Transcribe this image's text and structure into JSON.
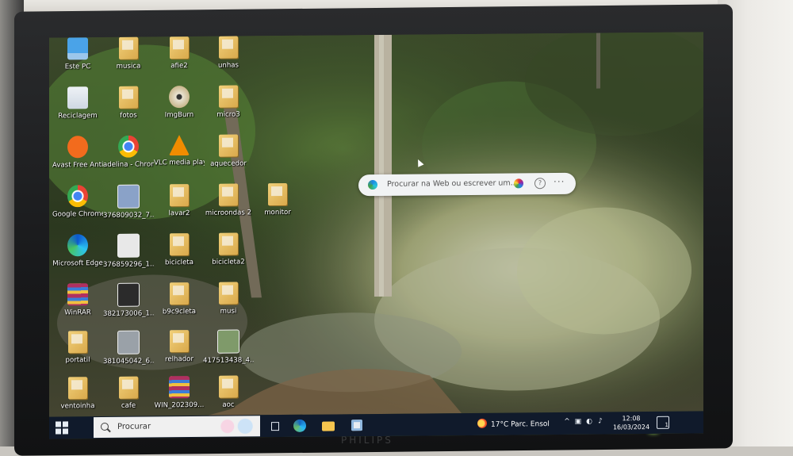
{
  "monitor": {
    "bottom_brand": "PHILIPS"
  },
  "desktop": {
    "icons": [
      {
        "label": "Este PC",
        "type": "pc",
        "color": "#4aa3e8"
      },
      {
        "label": "musica",
        "type": "folder"
      },
      {
        "label": "afie2",
        "type": "folder"
      },
      {
        "label": "unhas",
        "type": "folder"
      },
      {
        "label": "Reciclagem",
        "type": "recycle",
        "color": "#cfd8e3"
      },
      {
        "label": "fotos",
        "type": "folder"
      },
      {
        "label": "ImgBurn",
        "type": "disc",
        "color": "#c8b58a"
      },
      {
        "label": "micro3",
        "type": "folder"
      },
      {
        "label": "Avast Free Antivirus",
        "type": "avast",
        "color": "#f26b1d"
      },
      {
        "label": "adelina - Chrome",
        "type": "chrome"
      },
      {
        "label": "VLC media player",
        "type": "vlc",
        "color": "#f08c00"
      },
      {
        "label": "aquecedor",
        "type": "folder"
      },
      {
        "label": "Google Chrome",
        "type": "chrome"
      },
      {
        "label": "376809032_7...",
        "type": "photo",
        "color": "#8aa2c8"
      },
      {
        "label": "lavar2",
        "type": "folder"
      },
      {
        "label": "microondas 2",
        "type": "folder"
      },
      {
        "label": "monitor",
        "type": "folder"
      },
      {
        "label": "Microsoft Edge",
        "type": "edge"
      },
      {
        "label": "376859296_1...",
        "type": "file",
        "color": "#e8e8e8"
      },
      {
        "label": "bicicleta",
        "type": "folder"
      },
      {
        "label": "bicicleta2",
        "type": "folder"
      },
      {
        "label": "WinRAR",
        "type": "winrar",
        "color": "#b03060"
      },
      {
        "label": "382173006_1...",
        "type": "photo",
        "color": "#2b2b2b"
      },
      {
        "label": "b9c9cleta",
        "type": "folder"
      },
      {
        "label": "musi",
        "type": "folder"
      },
      {
        "label": "portatil",
        "type": "folder"
      },
      {
        "label": "381045042_6...",
        "type": "photo",
        "color": "#9aa1a8"
      },
      {
        "label": "relhador",
        "type": "folder"
      },
      {
        "label": "417513438_4...",
        "type": "photo",
        "color": "#7f9a6a"
      },
      {
        "label": "ventoinha",
        "type": "folder"
      },
      {
        "label": "cafe",
        "type": "folder"
      },
      {
        "label": "WIN_202309...",
        "type": "winrar",
        "color": "#b03060"
      },
      {
        "label": "aoc",
        "type": "folder"
      }
    ]
  },
  "edge_search": {
    "placeholder": "Procurar na Web ou escrever um...",
    "help": "?",
    "more": "···"
  },
  "taskbar": {
    "search_label": "Procurar",
    "weather": "17°C  Parc. Ensol",
    "tray": [
      "^",
      "▣",
      "◐",
      "♪"
    ],
    "time": "12:08",
    "date": "16/03/2024",
    "notifications": "1"
  }
}
